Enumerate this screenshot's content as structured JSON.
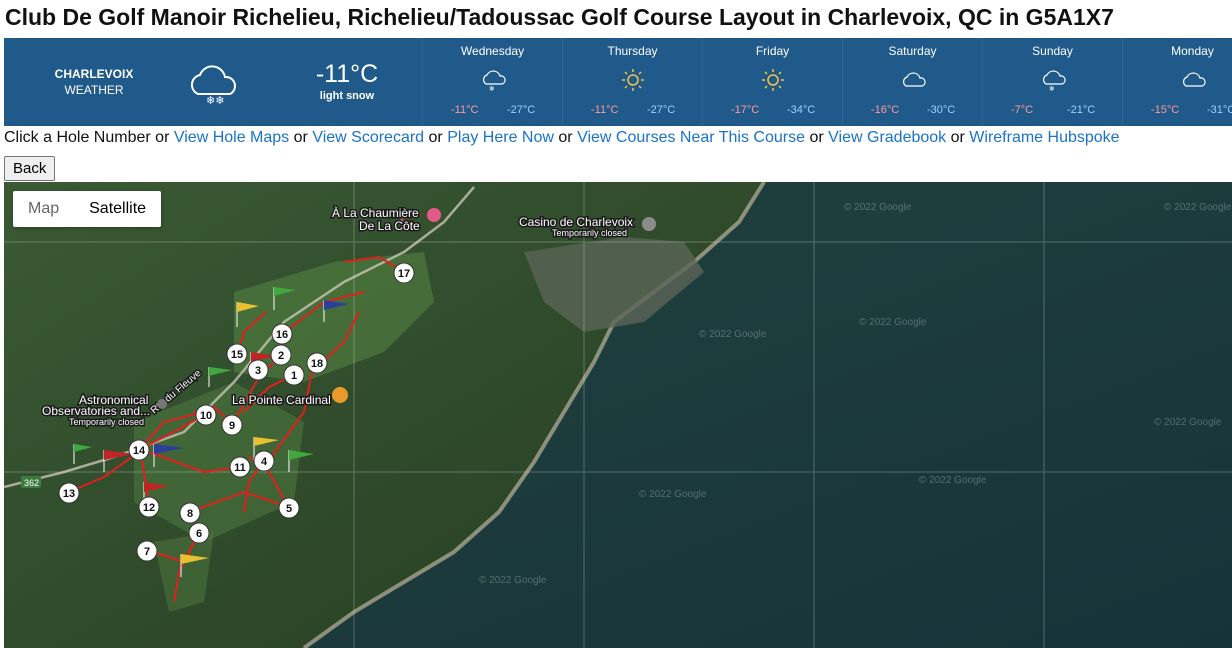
{
  "page": {
    "title": "Club De Golf Manoir Richelieu, Richelieu/Tadoussac Golf Course Layout in Charlevoix, QC in G5A1X7"
  },
  "weather": {
    "city": "CHARLEVOIX",
    "label": "WEATHER",
    "current_temp": "-11°C",
    "current_condition": "light snow",
    "current_icon": "snow-cloud-icon",
    "days": [
      {
        "name": "Wednesday",
        "icon": "snow-cloud-icon",
        "lo": "-11°C",
        "hi": "-27°C"
      },
      {
        "name": "Thursday",
        "icon": "sun-icon",
        "lo": "-11°C",
        "hi": "-27°C"
      },
      {
        "name": "Friday",
        "icon": "sun-icon",
        "lo": "-17°C",
        "hi": "-34°C"
      },
      {
        "name": "Saturday",
        "icon": "cloud-icon",
        "lo": "-16°C",
        "hi": "-30°C"
      },
      {
        "name": "Sunday",
        "icon": "snow-cloud-icon",
        "lo": "-7°C",
        "hi": "-21°C"
      },
      {
        "name": "Monday",
        "icon": "cloud-icon",
        "lo": "-15°C",
        "hi": "-31°C"
      }
    ]
  },
  "nav": {
    "prefix": "Click a Hole Number",
    "sep": "or",
    "links": [
      "View Hole Maps",
      "View Scorecard",
      "Play Here Now",
      "View Courses Near This Course",
      "View Gradebook",
      "Wireframe Hubspoke"
    ]
  },
  "back_label": "Back",
  "map": {
    "type_options": [
      "Map",
      "Satellite"
    ],
    "selected_type": "Satellite",
    "labels": {
      "chaumiere": "À La Chaumière\nDe La Côte",
      "casino": "Casino de Charlevoix",
      "casino_status": "Temporarily closed",
      "observatory": "Astronomical\nObservatories and...",
      "observatory_status": "Temporarily closed",
      "pointe": "La Pointe Cardinal",
      "road": "Rte du Fleuve",
      "road_shield": "362",
      "watermark": "© 2022 Google"
    },
    "holes": [
      "1",
      "2",
      "3",
      "4",
      "5",
      "6",
      "7",
      "8",
      "9",
      "10",
      "11",
      "12",
      "13",
      "14",
      "15",
      "16",
      "17",
      "18"
    ]
  },
  "colors": {
    "weather_bg": "#205a8a",
    "link": "#1a73c8",
    "hole_line": "#e0201e",
    "water": "#1c3a3b",
    "forest": "#2f4a2c"
  }
}
